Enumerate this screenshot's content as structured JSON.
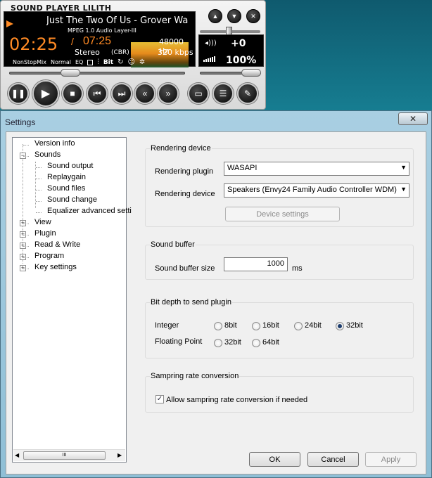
{
  "player": {
    "title": "SOUND PLAYER LILITH",
    "track": "Just The Two Of Us - Grover Wa",
    "format": "MPEG 1.0 Audio Layer-III",
    "elapsed": "02:25",
    "separator": "/",
    "total": "07:25",
    "samplerate": "48000 Hz",
    "channels": "Stereo",
    "bitrate_mode": "(CBR)",
    "bitrate": "320 kbps",
    "mode_nonstop": "NonStopMix",
    "mode_normal": "Normal",
    "eq_label": "EQ",
    "bit_label": "Bit",
    "pitch": "+0",
    "volume": "100%",
    "volume_level": 1.0,
    "seek_progress": 0.33,
    "top_buttons": [
      "up-icon",
      "down-icon",
      "close-icon"
    ],
    "transport_buttons": [
      "pause-icon",
      "play-icon",
      "stop-icon",
      "prev-track-icon",
      "next-track-icon",
      "rewind-icon",
      "fast-forward-icon",
      "open-folder-icon",
      "playlist-icon",
      "settings-icon"
    ]
  },
  "window": {
    "title": "Settings",
    "close_label": "✕"
  },
  "tree": {
    "items": [
      {
        "label": "Version info",
        "level": 0,
        "expander": ""
      },
      {
        "label": "Sounds",
        "level": 0,
        "expander": "−"
      },
      {
        "label": "Sound output",
        "level": 1,
        "expander": ""
      },
      {
        "label": "Replaygain",
        "level": 1,
        "expander": ""
      },
      {
        "label": "Sound files",
        "level": 1,
        "expander": ""
      },
      {
        "label": "Sound change",
        "level": 1,
        "expander": ""
      },
      {
        "label": "Equalizer advanced setti",
        "level": 1,
        "expander": ""
      },
      {
        "label": "View",
        "level": 0,
        "expander": "+"
      },
      {
        "label": "Plugin",
        "level": 0,
        "expander": "+"
      },
      {
        "label": "Read & Write",
        "level": 0,
        "expander": "+"
      },
      {
        "label": "Program",
        "level": 0,
        "expander": "+"
      },
      {
        "label": "Key settings",
        "level": 0,
        "expander": "+"
      }
    ],
    "scroll_grip": "III"
  },
  "rendering": {
    "group_label": "Rendering device",
    "plugin_label": "Rendering plugin",
    "plugin_value": "WASAPI",
    "device_label": "Rendering device",
    "device_value": "Speakers (Envy24 Family Audio Controller WDM)",
    "settings_button": "Device settings"
  },
  "buffer": {
    "group_label": "Sound buffer",
    "size_label": "Sound buffer size",
    "size_value": "1000",
    "unit": "ms"
  },
  "bitdepth": {
    "group_label": "Bit depth to send plugin",
    "integer_label": "Integer",
    "integer_options": [
      "8bit",
      "16bit",
      "24bit",
      "32bit"
    ],
    "integer_selected": "32bit",
    "float_label": "Floating Point",
    "float_options": [
      "32bit",
      "64bit"
    ],
    "float_selected": ""
  },
  "resample": {
    "group_label": "Sampring rate conversion",
    "checkbox_label": "Allow sampring rate conversion if needed",
    "checked": true
  },
  "footer": {
    "ok": "OK",
    "cancel": "Cancel",
    "apply": "Apply"
  }
}
